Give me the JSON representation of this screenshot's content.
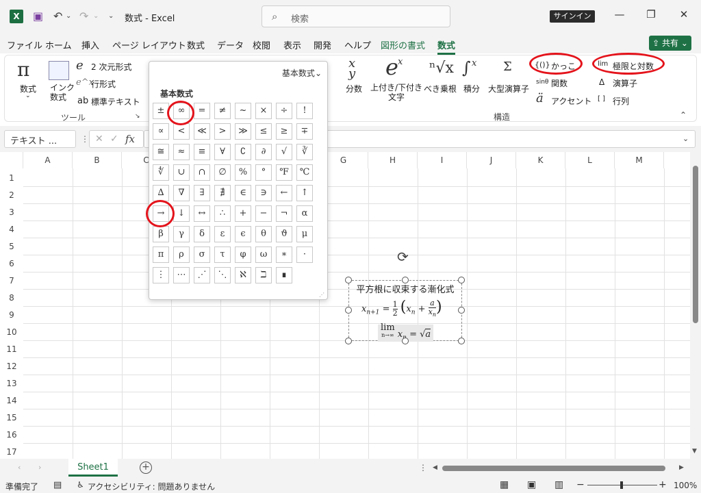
{
  "titlebar": {
    "doc_title": "数式 - Excel",
    "search_placeholder": "検索",
    "signin": "サインイン"
  },
  "menu": [
    "ファイル",
    "ホーム",
    "挿入",
    "ページ レイアウト",
    "数式",
    "データ",
    "校閲",
    "表示",
    "開発",
    "ヘルプ",
    "図形の書式",
    "数式"
  ],
  "share": "共有",
  "ribbon": {
    "equation": "数式",
    "ink": "インク\n数式",
    "prof": "2 次元形式",
    "linear": "行形式",
    "normal": "標準テキスト",
    "tools": "ツール",
    "fraction": "分数",
    "script": "上付き/下付き\n文字",
    "radical": "べき乗根",
    "integral": "積分",
    "large_op": "大型演算子",
    "bracket": "かっこ",
    "function": "関数",
    "accent": "アクセント",
    "limit": "極限と対数",
    "operator": "演算子",
    "matrix": "行列",
    "structures": "構造"
  },
  "namebox": "テキスト ...",
  "columns": [
    "A",
    "B",
    "C",
    "D",
    "E",
    "F",
    "G",
    "H",
    "I",
    "J",
    "K",
    "L",
    "M"
  ],
  "rows": [
    "1",
    "2",
    "3",
    "4",
    "5",
    "6",
    "7",
    "8",
    "9",
    "10",
    "11",
    "12",
    "13",
    "14",
    "15",
    "16",
    "17"
  ],
  "dropdown": {
    "header": "基本数式",
    "title": "基本数式",
    "symbols": [
      "±",
      "∞",
      "=",
      "≠",
      "~",
      "×",
      "÷",
      "!",
      "∝",
      "<",
      "≪",
      ">",
      "≫",
      "≤",
      "≥",
      "∓",
      "≅",
      "≈",
      "≡",
      "∀",
      "∁",
      "∂",
      "√",
      "∛",
      "∜",
      "∪",
      "∩",
      "∅",
      "%",
      "°",
      "℉",
      "℃",
      "∆",
      "∇",
      "∃",
      "∄",
      "∈",
      "∋",
      "←",
      "↑",
      "→",
      "↓",
      "↔",
      "∴",
      "+",
      "−",
      "¬",
      "α",
      "β",
      "γ",
      "δ",
      "ε",
      "ϵ",
      "θ",
      "ϑ",
      "μ",
      "π",
      "ρ",
      "σ",
      "τ",
      "φ",
      "ω",
      "∗",
      "·",
      "⋮",
      "⋯",
      "⋰",
      "⋱",
      "ℵ",
      "ℶ",
      "∎"
    ]
  },
  "equation_box": {
    "title": "平方根に収束する漸化式",
    "line1_lhs": "x",
    "line1_sub": "n+1",
    "line1_eq": "=",
    "half_num": "1",
    "half_den": "2",
    "xn": "x",
    "n": "n",
    "plus": "+",
    "a": "a",
    "lim": "lim",
    "lim_sub": "n→∞",
    "eq2": "=",
    "sqrt": "√",
    "sqrt_a": "a"
  },
  "sheet_tab": "Sheet1",
  "status": {
    "ready": "準備完了",
    "access": "アクセシビリティ: 問題ありません",
    "zoom": "100%"
  }
}
